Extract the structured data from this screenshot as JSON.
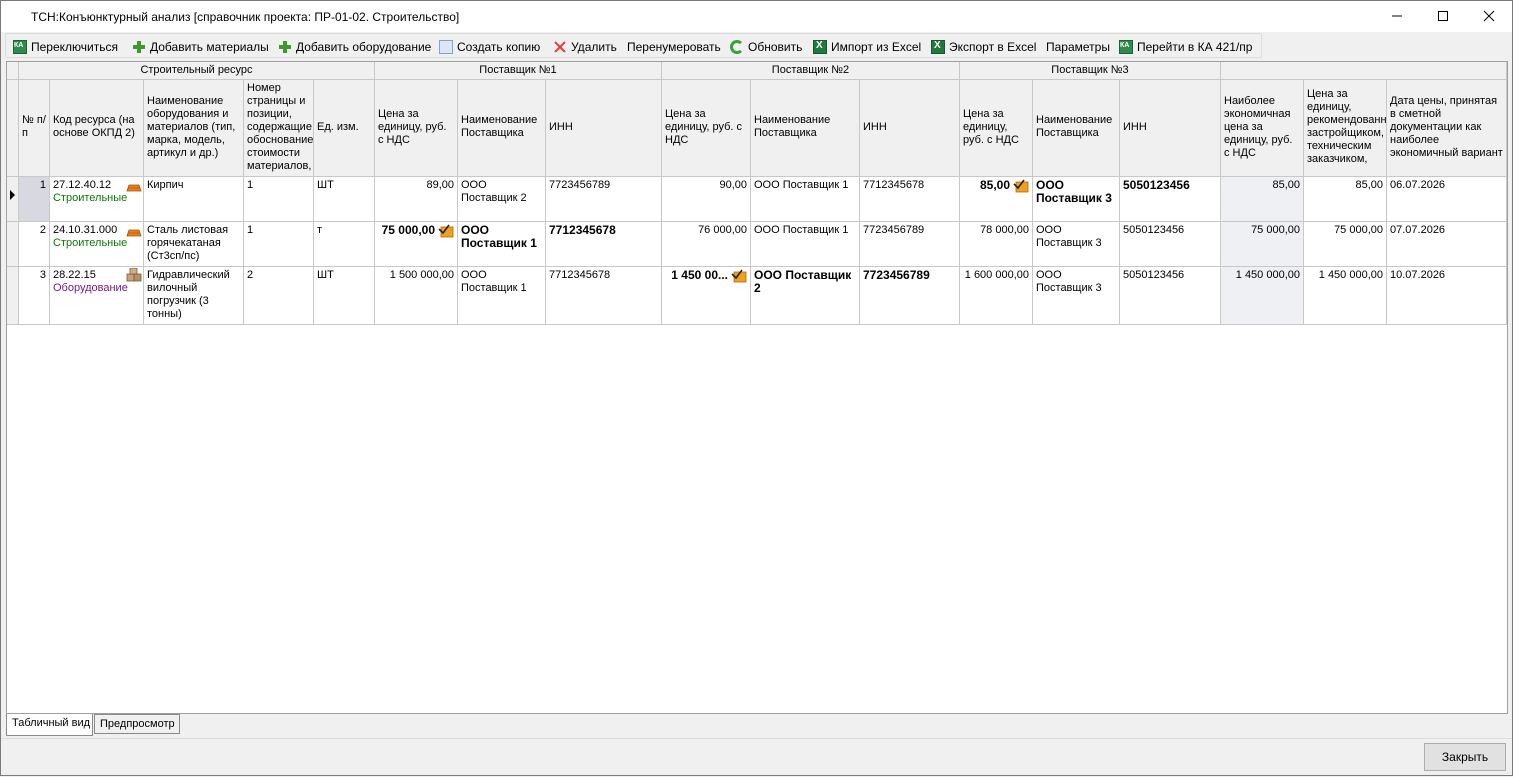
{
  "window": {
    "title": "ТСН:Конъюнктурный анализ [справочник проекта: ПР-01-02. Строительство]"
  },
  "toolbar": {
    "switch": "Переключиться",
    "add_materials": "Добавить материалы",
    "add_equipment": "Добавить оборудование",
    "copy": "Создать копию",
    "delete": "Удалить",
    "renumber": "Перенумеровать",
    "refresh": "Обновить",
    "import_excel": "Импорт из Excel",
    "export_excel": "Экспорт в Excel",
    "params": "Параметры",
    "goto_ka": "Перейти в КА 421/пр"
  },
  "groups": {
    "resource": "Строительный ресурс",
    "s1": "Поставщик №1",
    "s2": "Поставщик №2",
    "s3": "Поставщик №3"
  },
  "headers": {
    "num": "№ п/п",
    "code": "Код ресурса (на основе ОКПД 2)",
    "name": "Наименование оборудования и материалов (тип, марка, модель, артикул и др.)",
    "page": "Номер страницы и позиции, содержащие обоснование стоимости материалов,",
    "unit": "Ед. изм.",
    "price1": "Цена за единицу, руб. с НДС",
    "sname1": "Наименование Поставщика",
    "inn1": "ИНН",
    "price2": "Цена за единицу, руб. с НДС",
    "sname2": "Наименование Поставщика",
    "inn2": "ИНН",
    "price3": "Цена за единицу, руб. с НДС",
    "sname3": "Наименование Поставщика",
    "inn3": "ИНН",
    "best": "Наиболее экономичная цена за единицу, руб. с НДС",
    "recommended": "Цена за единицу, рекомендованн застройщиком, техническим заказчиком,",
    "date": "Дата цены, принятая в сметной документации как наиболее экономичный вариант"
  },
  "rows": [
    {
      "num": "1",
      "code": "27.12.40.12",
      "category": "Строительные",
      "category_icon": "bricks-icon",
      "name": "Кирпич",
      "page": "1",
      "unit": "ШТ",
      "price1": "89,00",
      "sname1": "ООО Поставщик 2",
      "inn1": "7723456789",
      "price2": "90,00",
      "sname2": "ООО Поставщик 1",
      "inn2": "7712345678",
      "price3": "85,00",
      "sname3": "ООО Поставщик 3",
      "inn3": "5050123456",
      "best": "85,00",
      "recommended": "85,00",
      "date": "06.07.2026",
      "chosen": 3
    },
    {
      "num": "2",
      "code": "24.10.31.000",
      "category": "Строительные",
      "category_icon": "bricks-icon",
      "name": "Сталь листовая горячекатаная (Ст3сп/пс)",
      "page": "1",
      "unit": "т",
      "price1": "75 000,00",
      "sname1": "ООО Поставщик 1",
      "inn1": "7712345678",
      "price2": "76 000,00",
      "sname2": "ООО Поставщик 1",
      "inn2": "7723456789",
      "price3": "78 000,00",
      "sname3": "ООО Поставщик 3",
      "inn3": "5050123456",
      "best": "75 000,00",
      "recommended": "75 000,00",
      "date": "07.07.2026",
      "chosen": 1
    },
    {
      "num": "3",
      "code": "28.22.15",
      "category": "Оборудование",
      "category_icon": "boxes-icon",
      "name": "Гидравлический вилочный погрузчик (3 тонны)",
      "page": "2",
      "unit": "ШТ",
      "price1": "1 500 000,00",
      "sname1": "ООО Поставщик 1",
      "inn1": "7712345678",
      "price2": "1 450 00...",
      "sname2": "ООО Поставщик 2",
      "inn2": "7723456789",
      "price3": "1 600 000,00",
      "sname3": "ООО Поставщик 3",
      "inn3": "5050123456",
      "best": "1 450 000,00",
      "recommended": "1 450 000,00",
      "date": "10.07.2026",
      "chosen": 2
    }
  ],
  "tabs": {
    "table": "Табличный вид",
    "preview": "Предпросмотр"
  },
  "footer": {
    "close": "Закрыть"
  }
}
